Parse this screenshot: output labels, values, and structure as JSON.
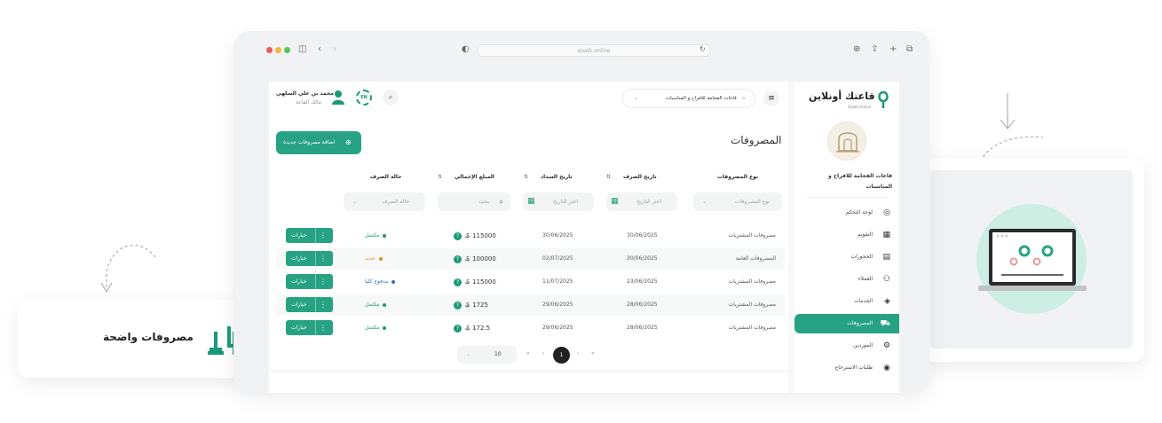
{
  "browser": {
    "url": "qaatk.online"
  },
  "header": {
    "venue_select": "قاعات الفخامة للافراح و المناسبات",
    "user_name": "محمد بن علي السلهي",
    "user_role": "مالك القاعة",
    "lang_badge": "EN"
  },
  "page": {
    "title": "المصروفات",
    "add_button": "اضافة مصروفات جديدة"
  },
  "table": {
    "headers": {
      "type": "نوع المصروفات",
      "spend_date": "تاريخ الصرف",
      "pay_date": "تاريخ السداد",
      "amount": "المبلغ الإجمالي",
      "status": "حالة الصرف"
    },
    "filters": {
      "type": "نوع المصروفات",
      "spend_date": "اختر التاريخ",
      "pay_date": "اختر التاريخ",
      "search": "بحث",
      "status": "حالة الصرف"
    },
    "rows": [
      {
        "type": "مصروفات المشتريات",
        "spend_date": "30/06/2025",
        "pay_date": "30/06/2025",
        "amount": "115000",
        "status": "مكتمل",
        "status_color": "#1b9a77",
        "options": "خيارات"
      },
      {
        "type": "المصروفات العامة",
        "spend_date": "30/06/2025",
        "pay_date": "02/07/2025",
        "amount": "100000",
        "status": "جديد",
        "status_color": "#e08a1e",
        "options": "خيارات"
      },
      {
        "type": "مصروفات المشتريات",
        "spend_date": "23/06/2025",
        "pay_date": "11/07/2025",
        "amount": "115000",
        "status": "مدفوع كليا",
        "status_color": "#2f6fb5",
        "options": "خيارات"
      },
      {
        "type": "مصروفات المشتريات",
        "spend_date": "28/06/2025",
        "pay_date": "29/06/2025",
        "amount": "1725",
        "status": "مكتمل",
        "status_color": "#1b9a77",
        "options": "خيارات"
      },
      {
        "type": "مصروفات المشتريات",
        "spend_date": "28/06/2025",
        "pay_date": "29/06/2025",
        "amount": "172.5",
        "status": "مكتمل",
        "status_color": "#1b9a77",
        "options": "خيارات"
      }
    ]
  },
  "pagination": {
    "page_size": "10",
    "current_page": "1"
  },
  "sidebar": {
    "brand": "قاعتك أونلاين",
    "brand_sub": "Qaatk.Online",
    "venue_name": "قاعات الفخامة للافراح و المناسبات",
    "items": [
      {
        "label": "لوحة التحكم",
        "icon": "dashboard-icon",
        "glyph": "◎"
      },
      {
        "label": "التقويم",
        "icon": "calendar-icon",
        "glyph": "▦"
      },
      {
        "label": "الحجوزات",
        "icon": "bookings-icon",
        "glyph": "▤"
      },
      {
        "label": "العملاء",
        "icon": "clients-icon",
        "glyph": "⚇"
      },
      {
        "label": "الخدمات",
        "icon": "services-icon",
        "glyph": "◈"
      },
      {
        "label": "المصروفات",
        "icon": "cart-icon",
        "glyph": "⛟"
      },
      {
        "label": "الموردين",
        "icon": "suppliers-icon",
        "glyph": "⚙"
      },
      {
        "label": "طلبات الاسترجاع",
        "icon": "refund-icon",
        "glyph": "◉"
      }
    ]
  },
  "promo": {
    "caption": "مصروفات واضحة"
  },
  "colors": {
    "accent": "#27a383",
    "accent_dark": "#1b9a77"
  }
}
